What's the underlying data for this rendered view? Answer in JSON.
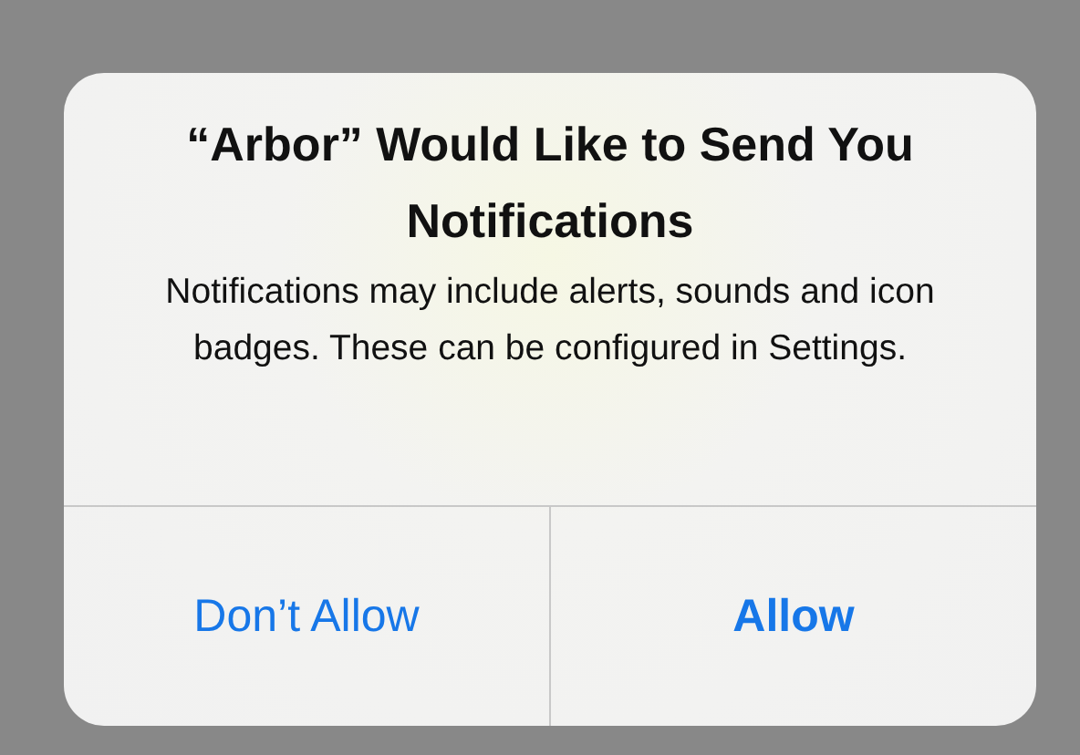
{
  "alert": {
    "title": "“Arbor” Would Like to Send You Notifications",
    "message": "Notifications may include alerts, sounds and icon badges. These can be configured in Settings.",
    "buttons": [
      {
        "label": "Don’t Allow",
        "kind": "cancel"
      },
      {
        "label": "Allow",
        "kind": "default"
      }
    ]
  }
}
